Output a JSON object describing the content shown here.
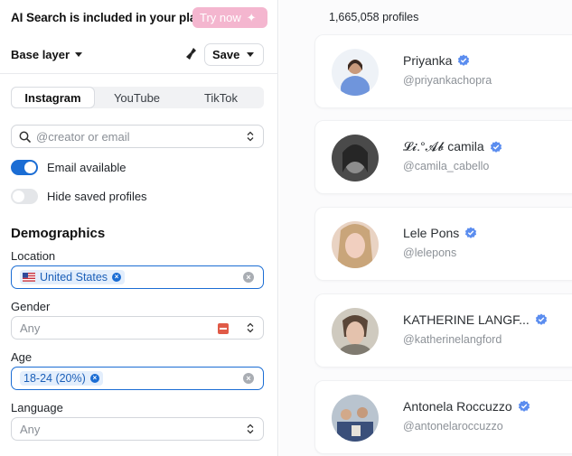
{
  "sidebar": {
    "promo_text": "AI Search is included in your plan",
    "try_button": "Try now",
    "base_layer": "Base layer",
    "save_label": "Save",
    "tabs": [
      {
        "label": "Instagram",
        "active": true
      },
      {
        "label": "YouTube",
        "active": false
      },
      {
        "label": "TikTok",
        "active": false
      }
    ],
    "search_placeholder": "@creator or email",
    "toggles": [
      {
        "label": "Email available",
        "on": true
      },
      {
        "label": "Hide saved profiles",
        "on": false
      }
    ],
    "demographics_title": "Demographics",
    "location": {
      "label": "Location",
      "chip": "United States"
    },
    "gender": {
      "label": "Gender",
      "placeholder": "Any"
    },
    "age": {
      "label": "Age",
      "chip": "18-24 (20%)"
    },
    "language": {
      "label": "Language",
      "placeholder": "Any"
    }
  },
  "main": {
    "profiles_count": "1,665,058 profiles",
    "profiles": [
      {
        "name": "Priyanka",
        "handle": "@priyankachopra",
        "verified": true
      },
      {
        "name": "𝓛𝓲.°𝓐𝓫 camila",
        "handle": "@camila_cabello",
        "verified": true
      },
      {
        "name": "Lele Pons",
        "handle": "@lelepons",
        "verified": true
      },
      {
        "name": "KATHERINE LANGF...",
        "handle": "@katherinelangford",
        "verified": true
      },
      {
        "name": "Antonela Roccuzzo",
        "handle": "@antonelaroccuzzo",
        "verified": true
      }
    ]
  },
  "colors": {
    "accent": "#1b6dd4",
    "try_button": "#f4b6cf",
    "verified": "#5b8def"
  }
}
